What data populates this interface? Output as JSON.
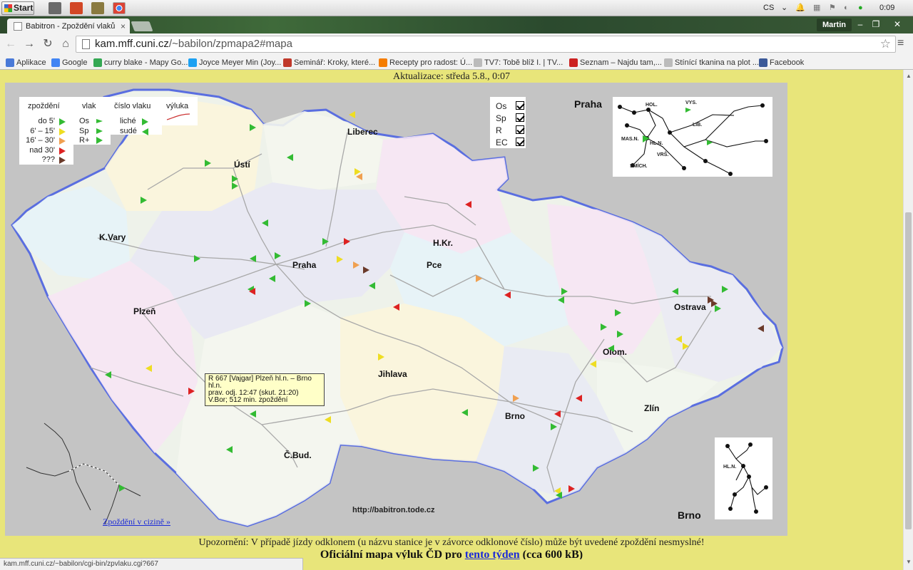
{
  "taskbar": {
    "start_label": "Start",
    "language": "CS",
    "clock": "0:09"
  },
  "browser": {
    "tab_title": "Babitron - Zpoždění vlaků",
    "user_name": "Martin",
    "url_host": "kam.mff.cuni.cz",
    "url_path": "/~babilon/zpmapa2#mapa",
    "bookmarks": [
      {
        "label": "Aplikace",
        "icon": "apps-icon",
        "color": "#4a7ad8"
      },
      {
        "label": "Google",
        "icon": "google-icon",
        "color": "#4285f4"
      },
      {
        "label": "curry blake - Mapy Go...",
        "icon": "maps-icon",
        "color": "#34a853"
      },
      {
        "label": "Joyce Meyer Min (Joy...",
        "icon": "twitter-icon",
        "color": "#1da1f2"
      },
      {
        "label": "Seminář: Kroky, které...",
        "icon": "seminar-icon",
        "color": "#c0392b"
      },
      {
        "label": "Recepty pro radost: Ú...",
        "icon": "blogger-icon",
        "color": "#f57d00"
      },
      {
        "label": "TV7: Tobě blíž I. | TV...",
        "icon": "page-icon",
        "color": "#bbbbbb"
      },
      {
        "label": "Seznam – Najdu tam,...",
        "icon": "seznam-icon",
        "color": "#cc2222"
      },
      {
        "label": "Stínící tkanina na plot ...",
        "icon": "page-icon",
        "color": "#bbbbbb"
      },
      {
        "label": "Facebook",
        "icon": "facebook-icon",
        "color": "#3b5998"
      }
    ]
  },
  "page": {
    "update_text": "Aktualizace: středa 5.8., 0:07",
    "legend": {
      "delay_header": "zpoždění",
      "train_header": "vlak",
      "number_header": "číslo vlaku",
      "closure_header": "výluka",
      "delay_rows": [
        "do 5'",
        "6' – 15'",
        "16' – 30'",
        "nad 30'",
        "???"
      ],
      "train_rows": [
        "Os",
        "Sp",
        "R+"
      ],
      "number_rows": [
        "liché",
        "sudé"
      ]
    },
    "filters": [
      {
        "label": "Os",
        "checked": true
      },
      {
        "label": "Sp",
        "checked": true
      },
      {
        "label": "R",
        "checked": true
      },
      {
        "label": "EC",
        "checked": true
      }
    ],
    "cities": {
      "liberec": "Liberec",
      "usti": "Ústí",
      "kvary": "K.Vary",
      "praha": "Praha",
      "hkr": "H.Kr.",
      "pce": "Pce",
      "plzen": "Plzeň",
      "ostrava": "Ostrava",
      "olom": "Olom.",
      "jihlava": "Jihlava",
      "brno": "Brno",
      "zlin": "Zlín",
      "cbud": "Č.Bud."
    },
    "insets": {
      "praha_title": "Praha",
      "praha_labels": [
        "HOL.",
        "VYS.",
        "LIB.",
        "MAS.N.",
        "HL.N.",
        "VRŠ.",
        "SMÍCH."
      ],
      "brno_title": "Brno",
      "brno_labels": [
        "HL.N."
      ]
    },
    "tooltip": {
      "line1": "R 667 [Vajgar] Plzeň hl.n. – Brno hl.n.",
      "line2": "prav. odj. 12:47 (skut. 21:20)",
      "line3": "V.Bor; 512 min. zpoždění"
    },
    "foreign_link": "Zpoždění v cizině »",
    "site_url": "http://babitron.tode.cz",
    "warning": "Upozornění: V případě jízdy odklonem (u názvu stanice je v závorce odklonové číslo) může být uvedené zpoždění nesmyslné!",
    "official_prefix": "Oficiální mapa výluk ČD pro",
    "official_link": "tento týden",
    "official_suffix": "(cca 600 kB)",
    "status_url": "kam.mff.cuni.cz/~babilon/cgi-bin/zpvlaku.cgi?667"
  },
  "colors": {
    "delay_0_5": "#33bb33",
    "delay_6_15": "#eedd22",
    "delay_16_30": "#f0a050",
    "delay_30plus": "#dd2222",
    "delay_unknown": "#6b3a2a",
    "map_border": "#5a6ee0",
    "page_bg": "#e8e57a"
  }
}
